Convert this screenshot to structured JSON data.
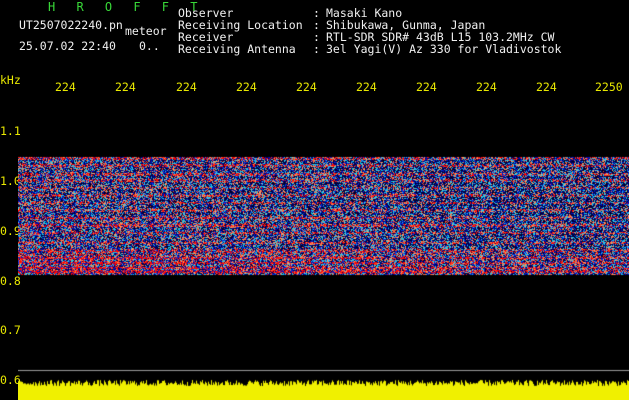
{
  "header": {
    "title": "H R O F F T",
    "filename": "UT2507022240.pn",
    "mode": "meteor",
    "datetime": "25.07.02 22:40",
    "counter": "0.."
  },
  "info": [
    {
      "label": "Observer",
      "sep": ":",
      "value": "Masaki Kano"
    },
    {
      "label": "Receiving Location",
      "sep": ":",
      "value": "Shibukawa, Gunma, Japan"
    },
    {
      "label": "Receiver",
      "sep": ":",
      "value": "RTL-SDR SDR# 43dB L15 103.2MHz CW"
    },
    {
      "label": "Receiving Antenna",
      "sep": ":",
      "value": "3el Yagi(V) Az 330 for Vladivostok"
    }
  ],
  "y_axis": {
    "unit": "kHz",
    "ticks": [
      "1.1",
      "1.0",
      "0.9",
      "0.8",
      "0.7",
      "0.6"
    ]
  },
  "x_axis": {
    "ticks": [
      "224",
      "224",
      "224",
      "224",
      "224",
      "224",
      "224",
      "224",
      "224",
      "2250"
    ]
  },
  "colors": {
    "background": "#000000",
    "title": "#38d838",
    "text": "#f0f0f0",
    "axis": "#e8e800",
    "signal_low": "#0a1a9a",
    "signal_mid": "#00c8e0",
    "signal_high": "#ff3030",
    "level": "#f0f000"
  }
}
